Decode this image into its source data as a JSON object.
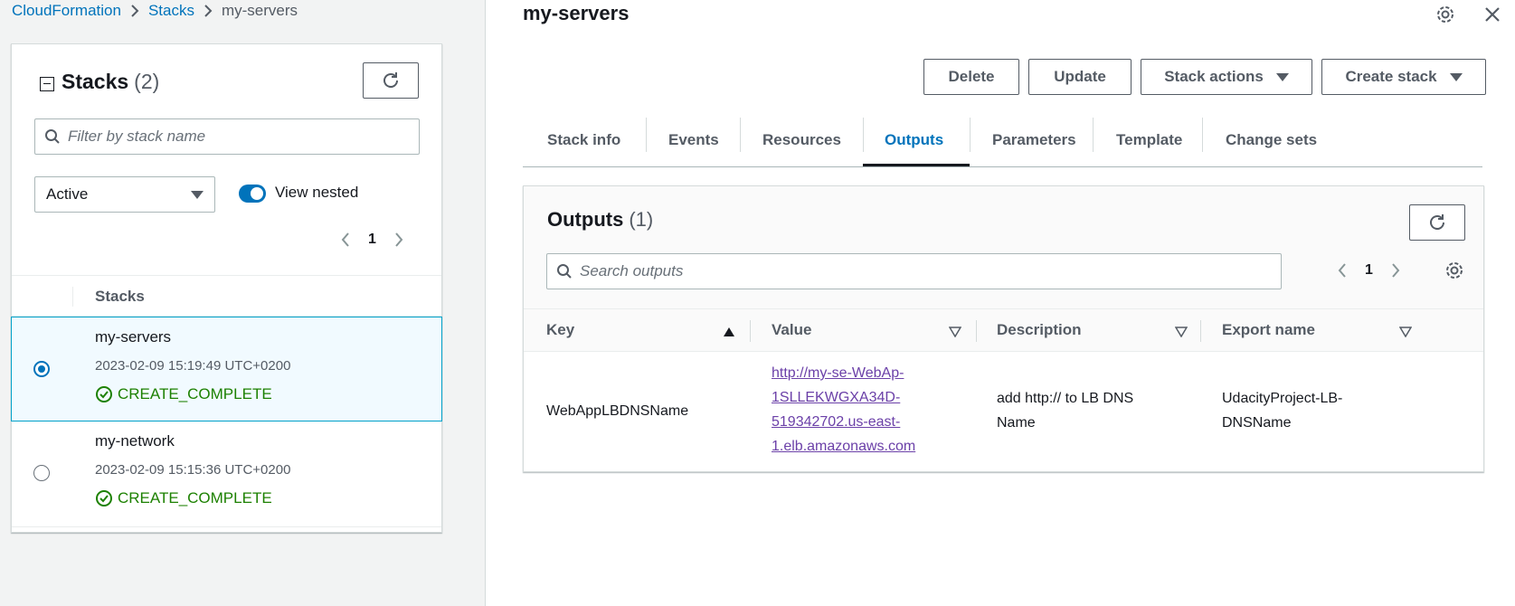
{
  "breadcrumb": {
    "items": [
      "CloudFormation",
      "Stacks",
      "my-servers"
    ]
  },
  "stacks_panel": {
    "title": "Stacks",
    "count": "(2)",
    "filter_placeholder": "Filter by stack name",
    "status_filter": "Active",
    "view_nested_label": "View nested",
    "view_nested_on": true,
    "page": "1",
    "column_header": "Stacks",
    "rows": [
      {
        "name": "my-servers",
        "date": "2023-02-09 15:19:49 UTC+0200",
        "status": "CREATE_COMPLETE",
        "selected": true
      },
      {
        "name": "my-network",
        "date": "2023-02-09 15:15:36 UTC+0200",
        "status": "CREATE_COMPLETE",
        "selected": false
      }
    ]
  },
  "detail": {
    "title": "my-servers",
    "actions": {
      "delete": "Delete",
      "update": "Update",
      "stack_actions": "Stack actions",
      "create_stack": "Create stack"
    },
    "tabs": [
      "Stack info",
      "Events",
      "Resources",
      "Outputs",
      "Parameters",
      "Template",
      "Change sets"
    ],
    "active_tab": "Outputs"
  },
  "outputs": {
    "title": "Outputs",
    "count": "(1)",
    "search_placeholder": "Search outputs",
    "page": "1",
    "columns": {
      "key": "Key",
      "value": "Value",
      "description": "Description",
      "export_name": "Export name"
    },
    "rows": [
      {
        "key": "WebAppLBDNSName",
        "value_lines": [
          "http://my-se-WebAp-",
          "1SLLEKWGXA34D-",
          "519342702.us-east-",
          "1.elb.amazonaws.com"
        ],
        "description_lines": [
          "add http:// to LB DNS",
          "Name"
        ],
        "export_lines": [
          "UdacityProject-LB-",
          "DNSName"
        ]
      }
    ]
  },
  "colors": {
    "link": "#0073bb",
    "success": "#1d8102",
    "visited_link": "#6b40a8",
    "selected_row_bg": "#f1faff"
  },
  "icons": [
    "chevron-right-icon",
    "refresh-icon",
    "search-icon",
    "collapse-icon",
    "caret-down-icon",
    "chevron-left-icon",
    "success-icon",
    "settings-icon",
    "close-icon",
    "sort-ascending-icon",
    "sort-icon",
    "resize-handle-icon"
  ]
}
